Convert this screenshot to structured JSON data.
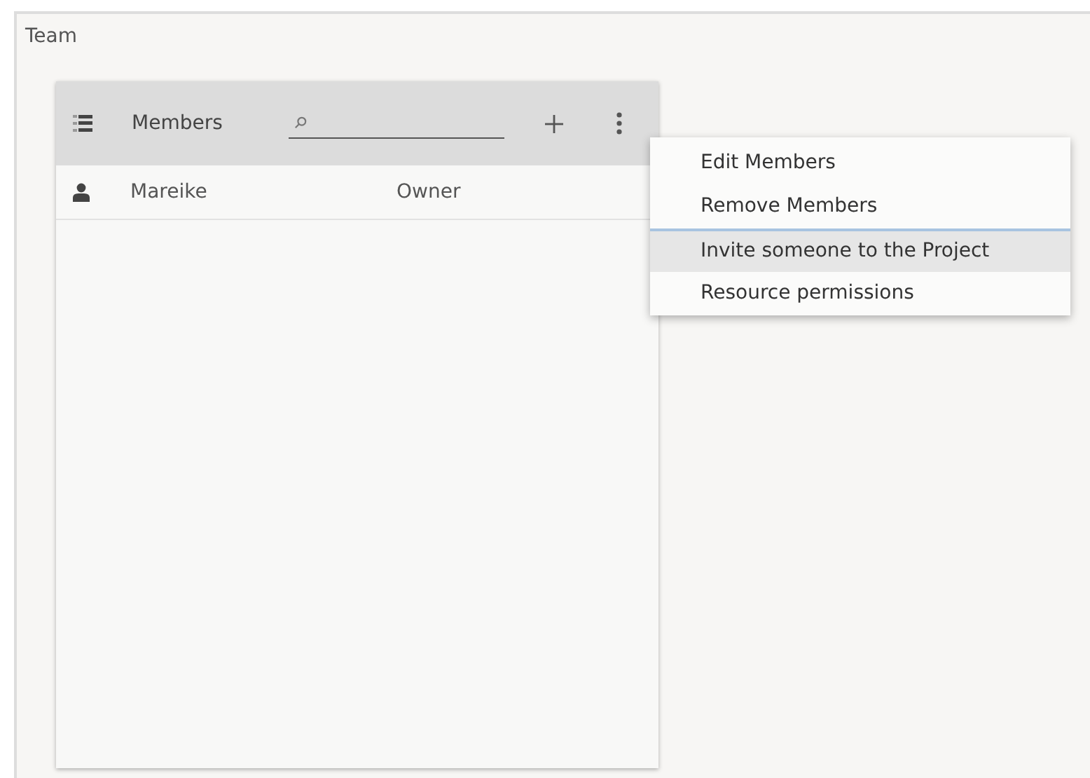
{
  "page": {
    "title": "Team"
  },
  "panel": {
    "title": "Members"
  },
  "members": [
    {
      "name": "Mareike",
      "role": "Owner"
    }
  ],
  "menu": {
    "items": [
      {
        "label": "Edit Members",
        "selected": false
      },
      {
        "label": "Remove Members",
        "selected": false
      },
      {
        "label": "Invite someone to the Project",
        "selected": true
      },
      {
        "label": "Resource permissions",
        "selected": false
      }
    ]
  }
}
